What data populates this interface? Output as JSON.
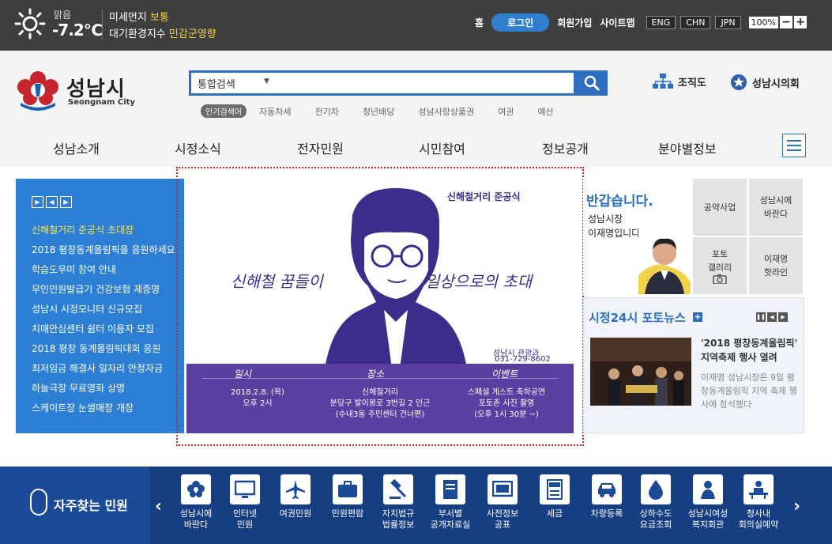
{
  "weather": {
    "condition": "맑음",
    "temperature": "-7.2℃",
    "dust_label": "미세먼지",
    "dust_value": "보통",
    "air_label": "대기환경지수",
    "air_value": "민감군영향"
  },
  "toplinks": {
    "home": "홈",
    "login": "로그인",
    "join": "회원가입",
    "sitemap": "사이트맵",
    "lang_en": "ENG",
    "lang_cn": "CHN",
    "lang_jp": "JPN",
    "zoom": "100%",
    "zoom_out": "−",
    "zoom_in": "+"
  },
  "logo": {
    "name": "성남시",
    "sub": "Seongnam City"
  },
  "search": {
    "category": "통합검색",
    "caret": "▼",
    "value": "",
    "popular_label": "인기검색어",
    "keywords": [
      "자동차세",
      "전기차",
      "청년배당",
      "성남사랑상품권",
      "여권",
      "예산"
    ]
  },
  "header_links": {
    "org": "조직도",
    "council": "성남시의회"
  },
  "nav": [
    "성남소개",
    "시정소식",
    "전자민원",
    "시민참여",
    "정보공개",
    "분야별정보"
  ],
  "notices": [
    "신해철거리 준공식 초대장",
    "2018 평창동계올림픽을 응원하세요",
    "학습도우미 참여 안내",
    "무인민원발급기 건강보험 제증명",
    "성남시 시정모니터 신규모집",
    "치매안심센터 쉼터 이용자 모집",
    "2018 평창 동계올림픽대회 응원",
    "최저임금 해결사 일자리 안정자금",
    "하늘극장 무료영화 상영",
    "스케이트장 눈썰매장 개장"
  ],
  "banner": {
    "title": "신해철거리 준공식",
    "slogan_left": "신해철 꿈들이",
    "slogan_right": "일상으로의 초대",
    "org": "성남시 관광과",
    "phone": "031-729-8602",
    "col1_head": "일시",
    "col1_line1": "2018.2.8. (목)",
    "col1_line2": "오후 2시",
    "col2_head": "장소",
    "col2_line1": "신해철거리",
    "col2_line2": "분당구 발이봉로 3번길 2 인근",
    "col2_line3": "(수내3동 주민센터 건너편)",
    "col3_head": "이벤트",
    "col3_line1": "스페셜 게스트 축하공연",
    "col3_line2": "포토존 사진 촬영",
    "col3_line3": "(오후 1시 30분 ~)"
  },
  "greeting": {
    "title": "반갑습니다.",
    "line1": "성남시장",
    "line2": "이재명입니다."
  },
  "quick": {
    "q1": "공약사업",
    "q2_l1": "성남시에",
    "q2_l2": "바란다",
    "q3_l1": "포토",
    "q3_l2": "갤러리",
    "q4_l1": "이재명",
    "q4_l2": "핫라인"
  },
  "photonews": {
    "title": "시정24시 포토뉴스",
    "headline": "'2018 평창동계올림픽' 지역축제 행사 열려",
    "body": "이재명 성남시장은 9일 평창동계올림픽 지역 축제 행사에 참석했다"
  },
  "bottom": {
    "title": "자주찾는 민원",
    "prev": "‹",
    "next": "›",
    "services": [
      {
        "label": "성남시에\n바란다"
      },
      {
        "label": "인터넷\n민원"
      },
      {
        "label": "여권민원"
      },
      {
        "label": "민원편람"
      },
      {
        "label": "자치법규\n법률정보"
      },
      {
        "label": "부서별\n공개자료실"
      },
      {
        "label": "사전정보\n공표"
      },
      {
        "label": "세금"
      },
      {
        "label": "차량등록"
      },
      {
        "label": "상하수도\n요금조회"
      },
      {
        "label": "성남시여성\n복지회관"
      },
      {
        "label": "청사내\n회의실예약"
      }
    ]
  }
}
